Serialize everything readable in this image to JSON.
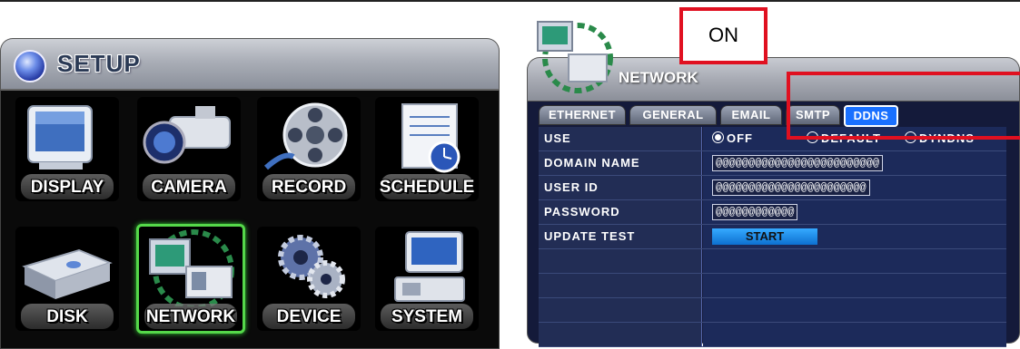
{
  "setup": {
    "title": "SETUP",
    "tiles": [
      {
        "label": "DISPLAY"
      },
      {
        "label": "CAMERA"
      },
      {
        "label": "RECORD"
      },
      {
        "label": "SCHEDULE"
      },
      {
        "label": "DISK"
      },
      {
        "label": "NETWORK",
        "selected": true
      },
      {
        "label": "DEVICE"
      },
      {
        "label": "SYSTEM"
      }
    ]
  },
  "network": {
    "title": "NETWORK",
    "tabs": [
      {
        "label": "ETHERNET"
      },
      {
        "label": "GENERAL"
      },
      {
        "label": "EMAIL"
      },
      {
        "label": "SMTP"
      },
      {
        "label": "DDNS",
        "active": true
      }
    ],
    "rows": {
      "use": {
        "label": "USE",
        "options": [
          "OFF",
          "DEFAULT",
          "DYNDNS"
        ],
        "selected": "OFF"
      },
      "domain": {
        "label": "DOMAIN NAME",
        "value": "@@@@@@@@@@@@@@@@@@@@@@@@@"
      },
      "user": {
        "label": "USER ID",
        "value": "@@@@@@@@@@@@@@@@@@@@@@@"
      },
      "password": {
        "label": "PASSWORD",
        "value": "@@@@@@@@@@@@"
      },
      "update": {
        "label": "UPDATE TEST",
        "button": "START"
      }
    }
  },
  "annotation": {
    "on_label": "ON",
    "color": "#e01020"
  },
  "colors": {
    "accent": "#1a70ff",
    "selection": "#55d84a"
  }
}
